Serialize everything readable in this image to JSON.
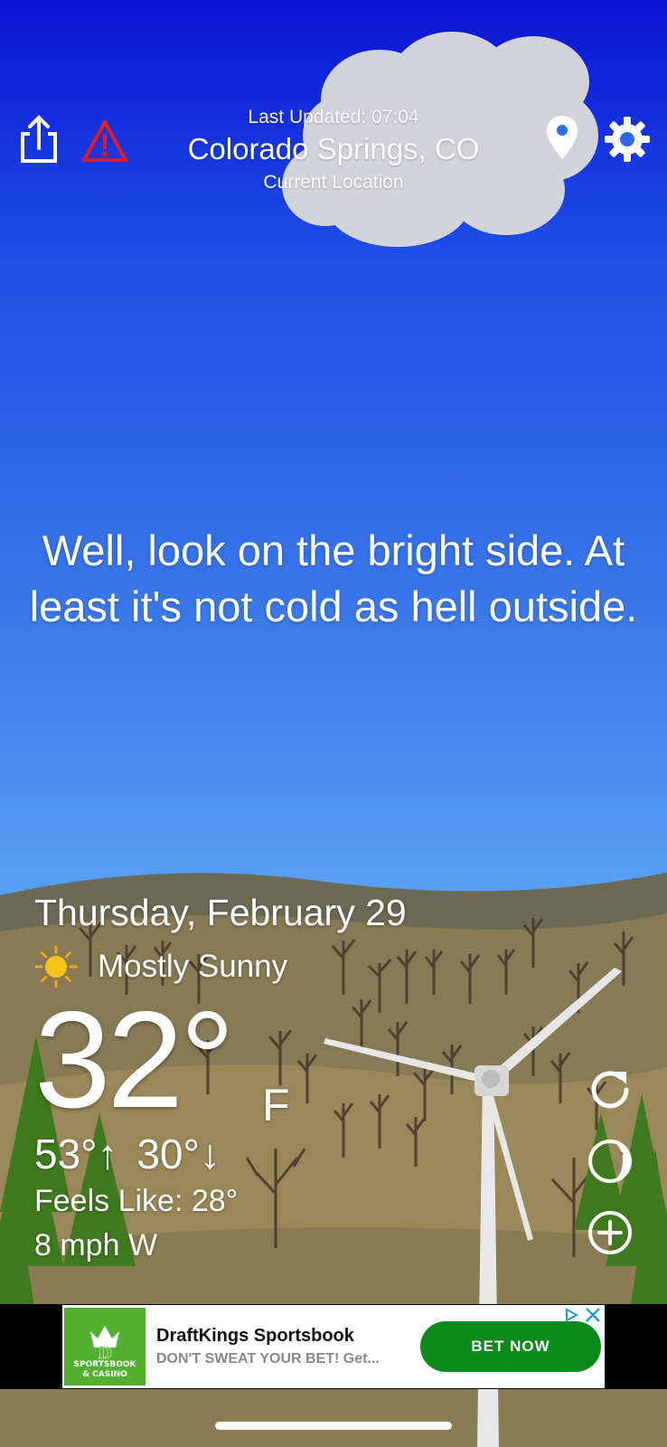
{
  "header": {
    "last_updated": "Last Updated: 07:04",
    "city": "Colorado Springs, CO",
    "location_label": "Current Location"
  },
  "icons": {
    "share": "share-icon",
    "alert": "warning-triangle-icon",
    "location": "map-pin-icon",
    "settings": "gear-icon",
    "condition": "sun-icon",
    "refresh": "refresh-icon",
    "moon": "moon-phase-icon",
    "add": "plus-circle-icon"
  },
  "quote": "Well, look on the bright side. At least it's not cold as hell outside.",
  "weather": {
    "date": "Thursday, February 29",
    "condition": "Mostly Sunny",
    "temperature": "32°",
    "unit": "F",
    "high": "53°↑",
    "low": "30°↓",
    "feels_like": "Feels Like: 28°",
    "wind": "8 mph W"
  },
  "ad": {
    "title": "DraftKings Sportsbook",
    "description": "DON'T SWEAT YOUR BET! Get...",
    "cta": "BET NOW",
    "logo_line1": "SPORTSBOOK",
    "logo_line2": "& CASINO"
  },
  "colors": {
    "sky_top": "#0a14d4",
    "sky_bottom": "#5aa3f6",
    "alert_red": "#e01e2a",
    "ad_cta_green": "#0a8a1c",
    "ad_logo_green": "#53b030"
  }
}
